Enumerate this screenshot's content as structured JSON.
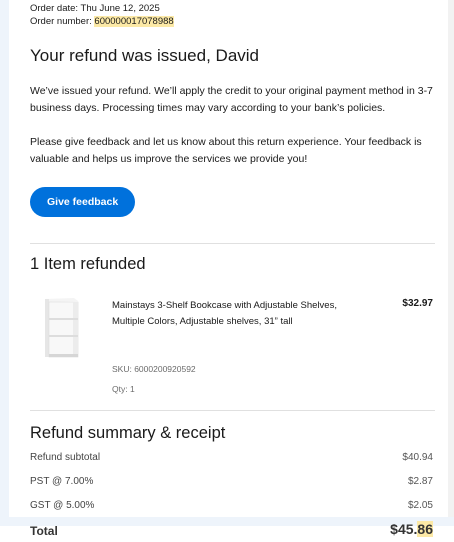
{
  "order": {
    "date_line": "Order date: Thu June 12, 2025",
    "number_label": "Order number: ",
    "number_value": "600000017078988"
  },
  "header": {
    "title": "Your refund was issued, David"
  },
  "body": {
    "paragraph1": "We’ve issued your refund. We’ll apply the credit to your original payment method in 3-7 business days. Processing times may vary according to your bank’s policies.",
    "paragraph2": "Please give feedback and let us know about this return experience. Your feedback is valuable and helps us improve the services we provide you!",
    "feedback_button": "Give feedback"
  },
  "items_section": {
    "title": "1 Item refunded",
    "items": [
      {
        "name": "Mainstays 3-Shelf Bookcase with Adjustable Shelves, Multiple Colors, Adjustable shelves, 31” tall",
        "price": "$32.97",
        "sku": "SKU: 6000200920592",
        "qty": "Qty: 1",
        "icon": "bookcase-product-image"
      }
    ]
  },
  "summary": {
    "title": "Refund summary & receipt",
    "rows": [
      {
        "label": "Refund subtotal",
        "value": "$40.94"
      },
      {
        "label": "PST @ 7.00%",
        "value": "$2.87"
      },
      {
        "label": "GST @ 5.00%",
        "value": "$2.05"
      }
    ],
    "total_label": "Total",
    "total_value_main": "$45.",
    "total_value_cents": "86"
  },
  "colors": {
    "accent": "#0071dc",
    "highlight": "#fce9a6",
    "side_bar": "#eef4fb"
  }
}
